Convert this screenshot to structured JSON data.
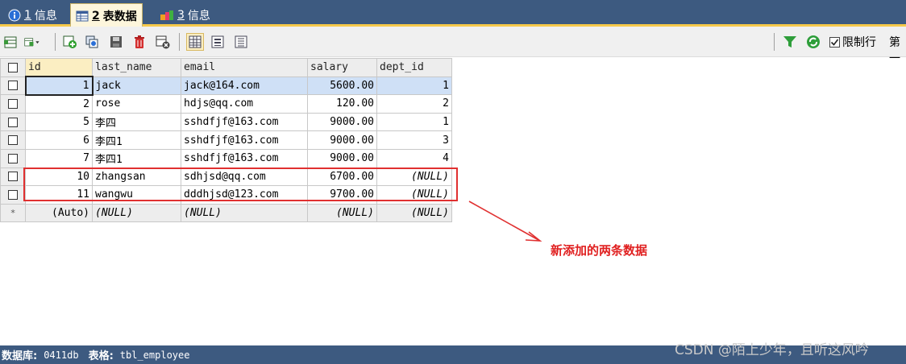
{
  "tabs": [
    {
      "num": "1",
      "label": "信息",
      "icon": "info-icon"
    },
    {
      "num": "2",
      "label": "表数据",
      "icon": "table-icon",
      "active": true
    },
    {
      "num": "3",
      "label": "信息",
      "icon": "blocks-icon"
    }
  ],
  "toolbar": {
    "filter_icon": "filter-icon",
    "refresh_icon": "refresh-icon",
    "limit_label": "限制行",
    "limit_checked": true,
    "first_label": "第一"
  },
  "grid": {
    "columns": [
      "id",
      "last_name",
      "email",
      "salary",
      "dept_id"
    ],
    "rows": [
      {
        "id": "1",
        "last_name": "jack",
        "email": "jack@164.com",
        "salary": "5600.00",
        "dept_id": "1"
      },
      {
        "id": "2",
        "last_name": "rose",
        "email": "hdjs@qq.com",
        "salary": "120.00",
        "dept_id": "2"
      },
      {
        "id": "5",
        "last_name": "李四",
        "email": "sshdfjf@163.com",
        "salary": "9000.00",
        "dept_id": "1"
      },
      {
        "id": "6",
        "last_name": "李四1",
        "email": "sshdfjf@163.com",
        "salary": "9000.00",
        "dept_id": "3"
      },
      {
        "id": "7",
        "last_name": "李四1",
        "email": "sshdfjf@163.com",
        "salary": "9000.00",
        "dept_id": "4"
      },
      {
        "id": "10",
        "last_name": "zhangsan",
        "email": "sdhjsd@qq.com",
        "salary": "6700.00",
        "dept_id": "(NULL)"
      },
      {
        "id": "11",
        "last_name": "wangwu",
        "email": "dddhjsd@123.com",
        "salary": "9700.00",
        "dept_id": "(NULL)"
      }
    ],
    "new_row": {
      "marker": "*",
      "id": "(Auto)",
      "last_name": "(NULL)",
      "email": "(NULL)",
      "salary": "(NULL)",
      "dept_id": "(NULL)"
    }
  },
  "annotation": {
    "text": "新添加的两条数据",
    "color": "#e02020"
  },
  "status": {
    "db_label": "数据库:",
    "db_value": "0411db",
    "table_label": "表格:",
    "table_value": "tbl_employee"
  },
  "watermark": "CSDN @陌上少年，且听这风吟",
  "colors": {
    "chrome": "#3d5a80",
    "active_tab": "#fdf6dc",
    "selection": "#cfe0f6",
    "annotation": "#e03030"
  }
}
